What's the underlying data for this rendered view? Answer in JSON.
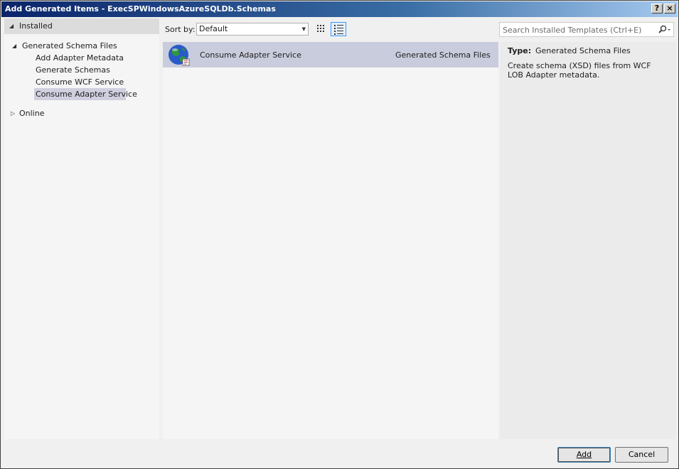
{
  "window": {
    "title": "Add Generated Items - ExecSPWindowsAzureSQLDb.Schemas",
    "help_glyph": "?",
    "close_glyph": "×"
  },
  "tree": {
    "installed": "Installed",
    "group": "Generated Schema Files",
    "items": [
      "Add Adapter Metadata",
      "Generate Schemas",
      "Consume WCF Service",
      "Consume Adapter Service"
    ],
    "selected_index": 3,
    "online": "Online"
  },
  "toolbar": {
    "sort_label": "Sort by:",
    "sort_value": "Default",
    "view_grid_icon": "small-icons-view-icon",
    "view_list_icon": "details-list-view-icon"
  },
  "search": {
    "placeholder": "Search Installed Templates (Ctrl+E)",
    "icon": "magnifier-icon"
  },
  "templates": [
    {
      "name": "Consume Adapter Service",
      "category": "Generated Schema Files",
      "icon": "globe-icon"
    }
  ],
  "details": {
    "type_label": "Type:",
    "type_value": "Generated Schema Files",
    "description": "Create schema (XSD) files from WCF LOB Adapter metadata."
  },
  "buttons": {
    "add": "Add",
    "cancel": "Cancel"
  },
  "colors": {
    "selection": "#c9ccdc",
    "title_gradient_start": "#0a246a",
    "title_gradient_end": "#a6caf0",
    "accent_border": "#3399ff"
  }
}
